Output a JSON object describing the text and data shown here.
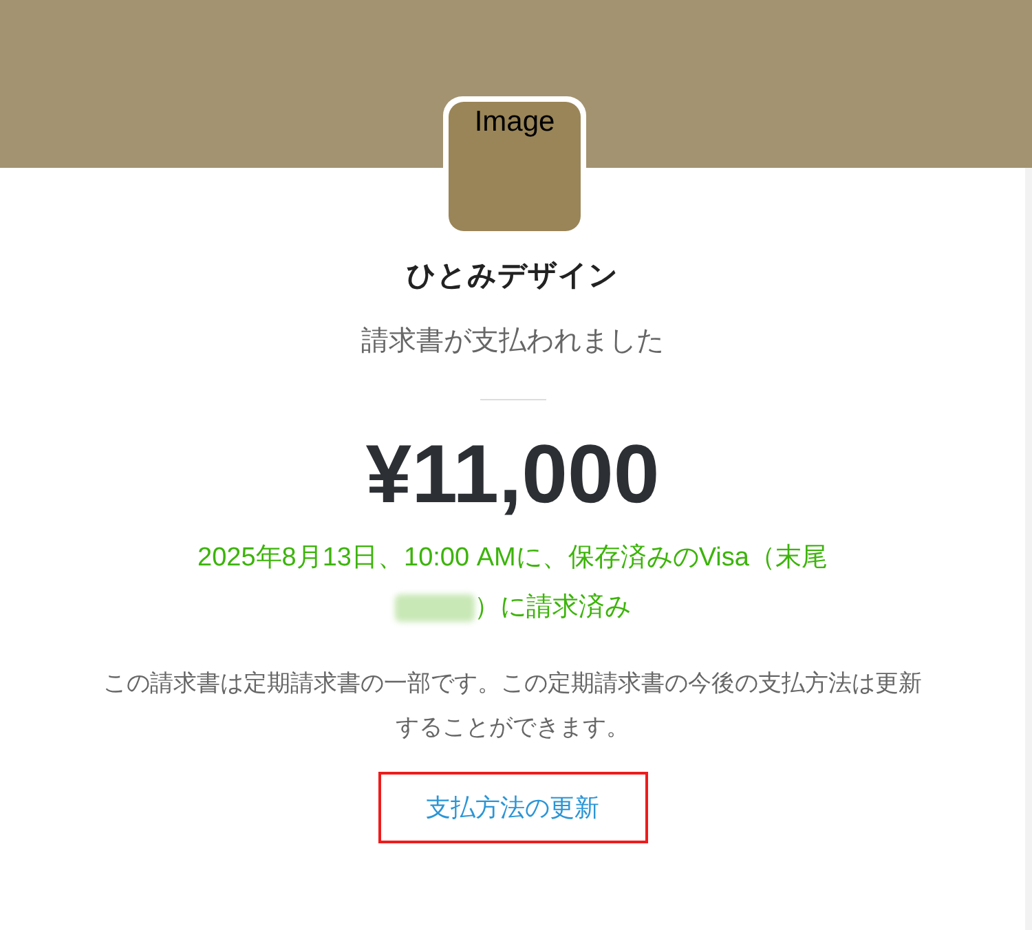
{
  "logo": {
    "label": "Image"
  },
  "merchant": "ひとみデザイン",
  "status": "請求書が支払われました",
  "amount": "¥11,000",
  "charge_note": {
    "line_1": "2025年8月13日、10:00 AMに、保存済みのVisa（末尾",
    "line_2": "）に請求済み"
  },
  "description": "この請求書は定期請求書の一部です。この定期請求書の今後の支払方法は更新することができます。",
  "button": {
    "label": "支払方法の更新"
  }
}
